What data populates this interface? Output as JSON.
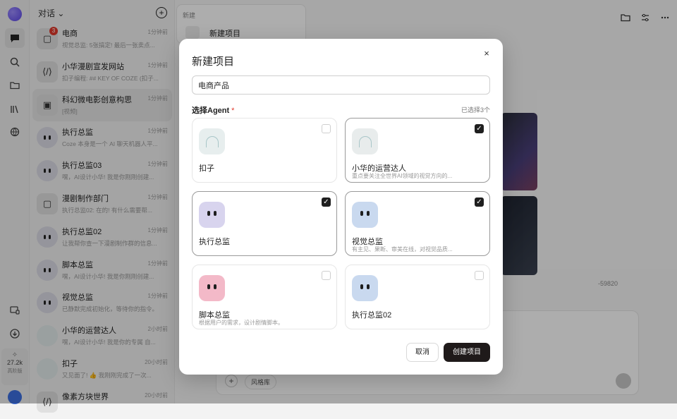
{
  "sidebar": {
    "title": "对话",
    "conversations": [
      {
        "name": "电商",
        "time": "1分钟前",
        "preview": "视觉总监: 5张搞定! 最后一张卖点...",
        "badge": "3",
        "avatar": "square"
      },
      {
        "name": "小华漫剧宣发网站",
        "time": "1分钟前",
        "preview": "扣子编程: ## KEY OF COZE (扣子...",
        "avatar": "code"
      },
      {
        "name": "科幻微电影创意构思",
        "time": "1分钟前",
        "preview": "[视频]",
        "avatar": "film"
      },
      {
        "name": "执行总监",
        "time": "1分钟前",
        "preview": "Coze 本身是一个 AI 聊天机器人平...",
        "avatar": "eyes"
      },
      {
        "name": "执行总监03",
        "time": "1分钟前",
        "preview": "嘿，AI设计小华! 我是你刚刚创建...",
        "avatar": "eyes"
      },
      {
        "name": "漫剧制作部门",
        "time": "1分钟前",
        "preview": "执行总监02: 在的! 有什么需要帮...",
        "avatar": "square"
      },
      {
        "name": "执行总监02",
        "time": "1分钟前",
        "preview": "让我帮你查一下漫剧制作群的信息...",
        "avatar": "eyes"
      },
      {
        "name": "脚本总监",
        "time": "1分钟前",
        "preview": "嘿，AI设计小华! 我是你刚刚创建...",
        "avatar": "eyes"
      },
      {
        "name": "视觉总监",
        "time": "1分钟前",
        "preview": "已静默完成初始化，等待你的指令。",
        "avatar": "eyes"
      },
      {
        "name": "小华的运营达人",
        "time": "2小时前",
        "preview": "嘿，AI设计小华! 我是你的专属 自...",
        "avatar": "ghost"
      },
      {
        "name": "扣子",
        "time": "20小时前",
        "preview": "又见面了! 👍 我刚刚完成了一次...",
        "avatar": "ghost"
      },
      {
        "name": "像素方块世界",
        "time": "20小时前",
        "preview": "",
        "avatar": "code"
      }
    ]
  },
  "rail": {
    "usage_star": "✧",
    "usage_count": "27.2k",
    "plan": "高阶版"
  },
  "main": {
    "new_label": "新建",
    "new_item": "新建项目",
    "history_count": "-59820",
    "style_library": "风格库"
  },
  "modal": {
    "title": "新建项目",
    "close": "×",
    "project_name": "电商产品",
    "section_label": "选择Agent",
    "required_mark": "*",
    "selected_count": "已选择3个",
    "agents": [
      {
        "name": "扣子",
        "desc": "",
        "checked": false,
        "color": "#e7eeee",
        "style": "ghost"
      },
      {
        "name": "小华的运营达人",
        "desc": "重点要关注全世界AI领域的视觉方向的...",
        "checked": true,
        "color": "#e8ecec",
        "style": "ghost"
      },
      {
        "name": "执行总监",
        "desc": "",
        "checked": true,
        "color": "#d8d4ee",
        "style": "eyes"
      },
      {
        "name": "视觉总监",
        "desc": "有主见、果断、审美在线，对视觉品质...",
        "checked": true,
        "color": "#c9d9ef",
        "style": "eyes"
      },
      {
        "name": "脚本总监",
        "desc": "根据用户的需求，设计剧情脚本。",
        "checked": false,
        "color": "#f3b9c8",
        "style": "eyes"
      },
      {
        "name": "执行总监02",
        "desc": "",
        "checked": false,
        "color": "#c9d9ef",
        "style": "eyes"
      }
    ],
    "cancel": "取消",
    "create": "创建项目",
    "check_mark": "✓"
  }
}
